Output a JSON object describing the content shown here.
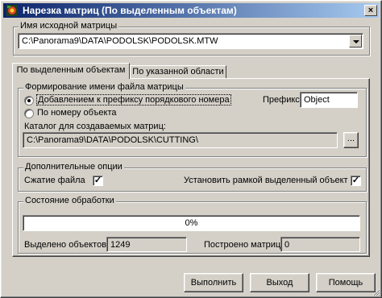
{
  "window": {
    "title": "Нарезка матриц (По выделенным объектам)",
    "close_glyph": "×"
  },
  "source": {
    "label": "Имя исходной матрицы",
    "value": "C:\\Panorama9\\DATA\\PODOLSK\\PODOLSK.MTW"
  },
  "tabs": [
    {
      "label": "По выделенным объектам",
      "selected": true
    },
    {
      "label": "По указанной области",
      "selected": false
    }
  ],
  "naming": {
    "label": "Формирование имени файла матрицы",
    "option_prefix": "Добавлением к префиксу порядкового номера",
    "option_number": "По номеру объекта",
    "prefix_label": "Префикс",
    "prefix_value": "Object",
    "catalog_label": "Каталог для создаваемых матриц:",
    "catalog_value": "C:\\Panorama9\\DATA\\PODOLSK\\CUTTING\\",
    "browse_label": "..."
  },
  "options": {
    "label": "Дополнительные опции",
    "compress_label": "Сжатие файла",
    "compress_checked": true,
    "frame_label": "Установить рамкой выделенный объект",
    "frame_checked": true,
    "check_glyph": "✓"
  },
  "status": {
    "label": "Состояние обработки",
    "progress_text": "0%",
    "progress_fraction": 0,
    "selected_label": "Выделено объектов",
    "selected_value": "1249",
    "built_label": "Построено матриц",
    "built_value": "0"
  },
  "buttons": {
    "run": "Выполнить",
    "exit": "Выход",
    "help": "Помощь"
  }
}
